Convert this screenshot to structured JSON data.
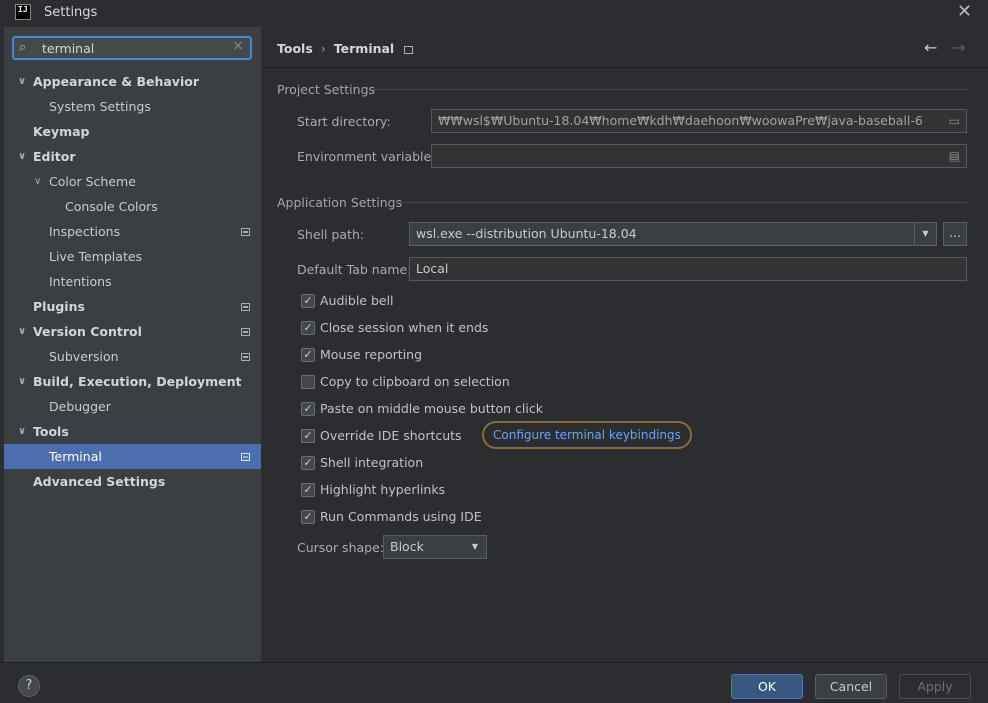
{
  "window": {
    "title": "Settings",
    "app_icon": "IJ"
  },
  "search": {
    "value": "terminal"
  },
  "sidebar": {
    "items": [
      {
        "label": "Appearance & Behavior",
        "level": 0,
        "bold": true,
        "expanded": true
      },
      {
        "label": "System Settings",
        "level": 1
      },
      {
        "label": "Keymap",
        "level": 0,
        "bold": true
      },
      {
        "label": "Editor",
        "level": 0,
        "bold": true,
        "expanded": true
      },
      {
        "label": "Color Scheme",
        "level": 1,
        "expanded": true
      },
      {
        "label": "Console Colors",
        "level": 2
      },
      {
        "label": "Inspections",
        "level": 1,
        "badge": true
      },
      {
        "label": "Live Templates",
        "level": 1
      },
      {
        "label": "Intentions",
        "level": 1
      },
      {
        "label": "Plugins",
        "level": 0,
        "bold": true,
        "badge": true
      },
      {
        "label": "Version Control",
        "level": 0,
        "bold": true,
        "expanded": true,
        "badge": true
      },
      {
        "label": "Subversion",
        "level": 1,
        "badge": true
      },
      {
        "label": "Build, Execution, Deployment",
        "level": 0,
        "bold": true,
        "expanded": true
      },
      {
        "label": "Debugger",
        "level": 1
      },
      {
        "label": "Tools",
        "level": 0,
        "bold": true,
        "expanded": true
      },
      {
        "label": "Terminal",
        "level": 1,
        "selected": true,
        "badge": true
      },
      {
        "label": "Advanced Settings",
        "level": 0,
        "bold": true
      }
    ]
  },
  "breadcrumb": {
    "parent": "Tools",
    "separator": "›",
    "current": "Terminal"
  },
  "project_settings": {
    "title": "Project Settings",
    "start_directory_label": "Start directory:",
    "start_directory_value": "₩₩wsl$₩Ubuntu-18.04₩home₩kdh₩daehoon₩woowaPre₩java-baseball-6",
    "env_vars_label": "Environment variables:",
    "env_vars_value": ""
  },
  "application_settings": {
    "title": "Application Settings",
    "shell_path_label": "Shell path:",
    "shell_path_value": "wsl.exe --distribution Ubuntu-18.04",
    "browse_label": "...",
    "default_tab_label": "Default Tab name:",
    "default_tab_value": "Local",
    "checkboxes": [
      {
        "label": "Audible bell",
        "checked": true
      },
      {
        "label": "Close session when it ends",
        "checked": true
      },
      {
        "label": "Mouse reporting",
        "checked": true
      },
      {
        "label": "Copy to clipboard on selection",
        "checked": false
      },
      {
        "label": "Paste on middle mouse button click",
        "checked": true
      },
      {
        "label": "Override IDE shortcuts",
        "checked": true
      },
      {
        "label": "Shell integration",
        "checked": true
      },
      {
        "label": "Highlight hyperlinks",
        "checked": true
      },
      {
        "label": "Run Commands using IDE",
        "checked": true
      }
    ],
    "configure_link": "Configure terminal keybindings",
    "cursor_shape_label": "Cursor shape:",
    "cursor_shape_value": "Block"
  },
  "footer": {
    "help": "?",
    "ok": "OK",
    "cancel": "Cancel",
    "apply": "Apply"
  },
  "colors": {
    "accent": "#4b6eaf",
    "link": "#6ea3f0",
    "ok_button": "#365880"
  }
}
